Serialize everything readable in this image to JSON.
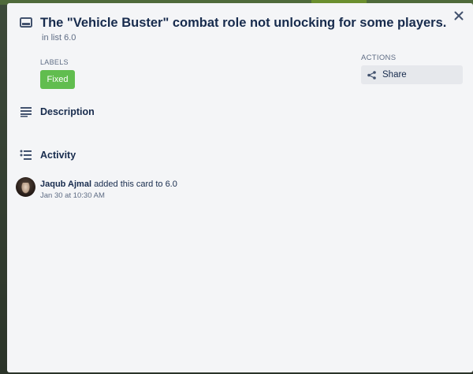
{
  "card": {
    "title": "The \"Vehicle Buster\" combat role not unlocking for some players.",
    "list_prefix": "in list",
    "list_name": "6.0"
  },
  "labels": {
    "heading": "LABELS",
    "items": [
      {
        "name": "Fixed",
        "color": "#61bd4f"
      }
    ]
  },
  "actions": {
    "heading": "ACTIONS",
    "share_label": "Share"
  },
  "description": {
    "title": "Description"
  },
  "activity": {
    "title": "Activity",
    "items": [
      {
        "member": "Jaqub Ajmal",
        "text": "added this card to 6.0",
        "time": "Jan 30 at 10:30 AM"
      }
    ]
  },
  "icons": {
    "card": "card-icon",
    "close": "close-icon",
    "share": "share-icon",
    "description": "description-icon",
    "activity": "activity-icon"
  }
}
